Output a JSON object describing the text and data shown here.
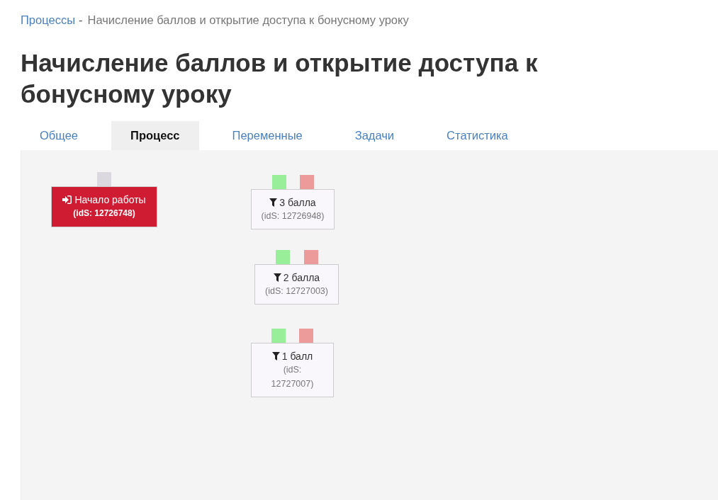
{
  "breadcrumb": {
    "link": "Процессы",
    "separator": "-",
    "current": "Начисление баллов и открытие доступа к бонусному уроку"
  },
  "title": "Начисление баллов и открытие доступа к бонусному уроку",
  "tabs": [
    {
      "label": "Общее",
      "selected": false
    },
    {
      "label": "Процесс",
      "selected": true
    },
    {
      "label": "Переменные",
      "selected": false
    },
    {
      "label": "Задачи",
      "selected": false
    },
    {
      "label": "Статистика",
      "selected": false
    }
  ],
  "diagram": {
    "nodes": [
      {
        "kind": "start",
        "label": "Начало работы",
        "ids": "(idS: 12726748)",
        "ports": [
          {
            "color": "#dcd8e0"
          }
        ]
      },
      {
        "kind": "filter",
        "label": "3 балла",
        "ids": "(idS: 12726948)",
        "ports": [
          {
            "color": "#99ee99"
          },
          {
            "color": "#ec9a9a"
          }
        ]
      },
      {
        "kind": "filter",
        "label": "2 балла",
        "ids": "(idS: 12727003)",
        "ports": [
          {
            "color": "#99ee99"
          },
          {
            "color": "#ec9a9a"
          }
        ]
      },
      {
        "kind": "filter",
        "label": "1 балл",
        "ids": "(idS: 12727007)",
        "ports": [
          {
            "color": "#99ee99"
          },
          {
            "color": "#ec9a9a"
          }
        ]
      }
    ]
  }
}
